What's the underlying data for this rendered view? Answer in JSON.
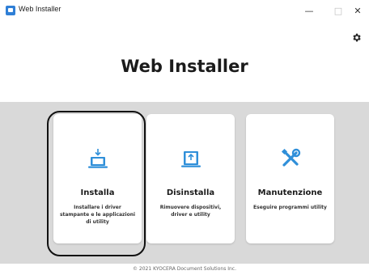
{
  "window": {
    "title": "Web Installer",
    "minimize_glyph": "—",
    "maximize_glyph": "□",
    "close_glyph": "✕"
  },
  "header": {
    "title": "Web Installer",
    "settings_icon": "gear-icon"
  },
  "cards": [
    {
      "title": "Installa",
      "description": "Installare i driver stampante e le applicazioni di utility",
      "icon": "laptop-download-icon",
      "selected": true
    },
    {
      "title": "Disinstalla",
      "description": "Rimuovere dispositivi, driver e utility",
      "icon": "laptop-upload-icon",
      "selected": false
    },
    {
      "title": "Manutenzione",
      "description": "Eseguire programmi utility",
      "icon": "tools-icon",
      "selected": false
    }
  ],
  "footer": {
    "copyright": "© 2021 KYOCERA Document Solutions Inc."
  },
  "colors": {
    "accent": "#2f8fd9",
    "content_bg": "#d9d9d9",
    "card_bg": "#ffffff",
    "focus_ring": "#111111"
  }
}
